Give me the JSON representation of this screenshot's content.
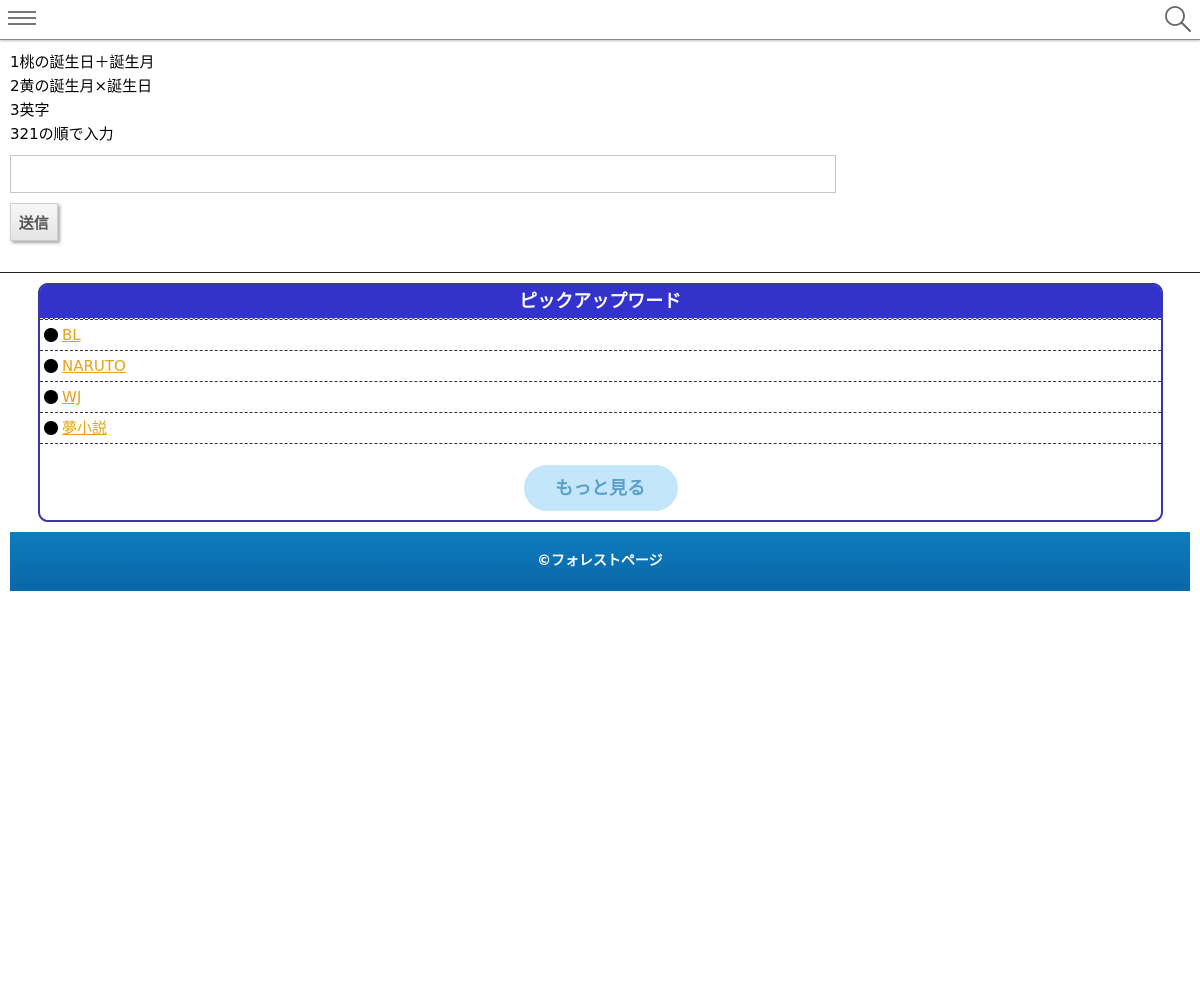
{
  "header": {
    "menu_icon": "hamburger-menu-icon",
    "search_icon": "magnifier-search-icon"
  },
  "instructions": {
    "lines": [
      "1桃の誕生日＋誕生月",
      "2黄の誕生月×誕生日",
      "3英字",
      "321の順で入力"
    ]
  },
  "form": {
    "input_value": "",
    "submit_label": "送信"
  },
  "pickup": {
    "title": "ピックアップワード",
    "items": [
      {
        "label": "BL"
      },
      {
        "label": "NARUTO"
      },
      {
        "label": "WJ"
      },
      {
        "label": "夢小説"
      }
    ],
    "more_label": "もっと見る"
  },
  "footer": {
    "copyright": "©フォレストページ"
  },
  "colors": {
    "pickup_header": "#3333cc",
    "link": "#e6a21a",
    "more_button_bg": "#c3e6fb",
    "footer_bg": "#0a6fb0"
  }
}
